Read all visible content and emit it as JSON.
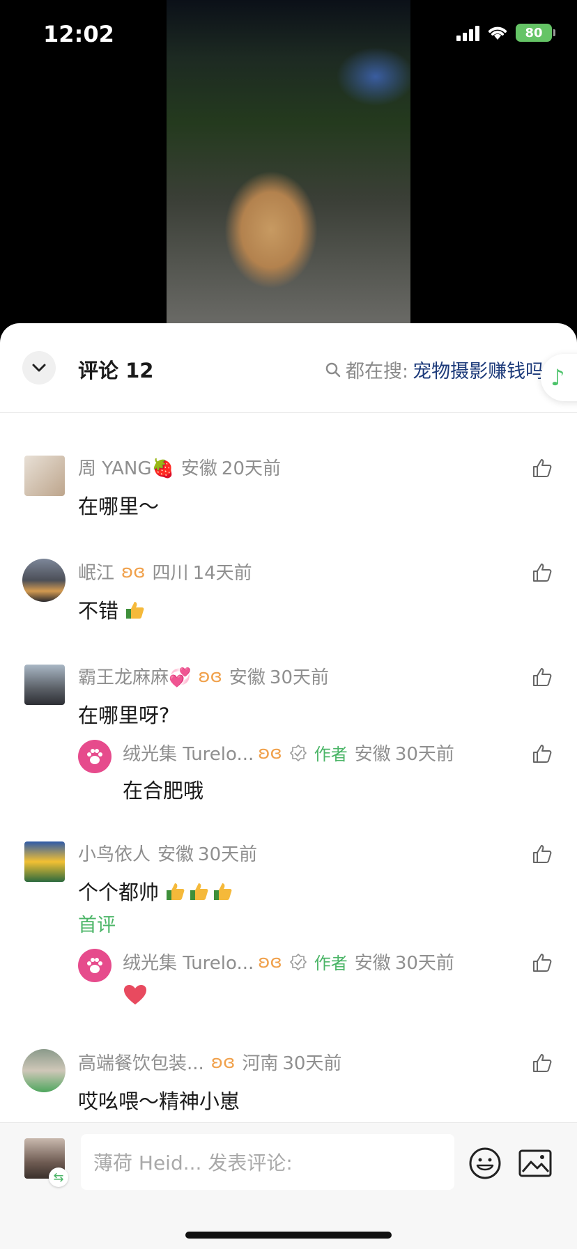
{
  "status": {
    "time": "12:02",
    "battery": "80"
  },
  "header": {
    "title": "评论 12",
    "search_prefix": "都在搜:",
    "search_term": "宠物摄影赚钱吗"
  },
  "comments": [
    {
      "user": "周 YANG🍓",
      "region": "安徽",
      "time": "20天前",
      "text": "在哪里～"
    },
    {
      "user": "岷江",
      "region": "四川",
      "time": "14天前",
      "text": "不错"
    },
    {
      "user": "霸王龙麻麻💞",
      "region": "安徽",
      "time": "30天前",
      "text": "在哪里呀?"
    },
    {
      "user": "小鸟依人",
      "region": "安徽",
      "time": "30天前",
      "text": "个个都帅",
      "tag": "首评"
    },
    {
      "user": "高端餐饮包装...",
      "region": "河南",
      "time": "30天前",
      "text": "哎吆喂～精神小崽"
    }
  ],
  "replies": [
    {
      "user": "绒光集 Turelo...",
      "badge": "作者",
      "region": "安徽",
      "time": "30天前",
      "text": "在合肥哦"
    },
    {
      "user": "绒光集 Turelo...",
      "badge": "作者",
      "region": "安徽",
      "time": "30天前",
      "text": ""
    }
  ],
  "input": {
    "placeholder": "薄荷 Heid... 发表评论:"
  },
  "colors": {
    "accent": "#4bb567",
    "search_term": "#1c3a7a",
    "paw": "#e64b8c"
  }
}
